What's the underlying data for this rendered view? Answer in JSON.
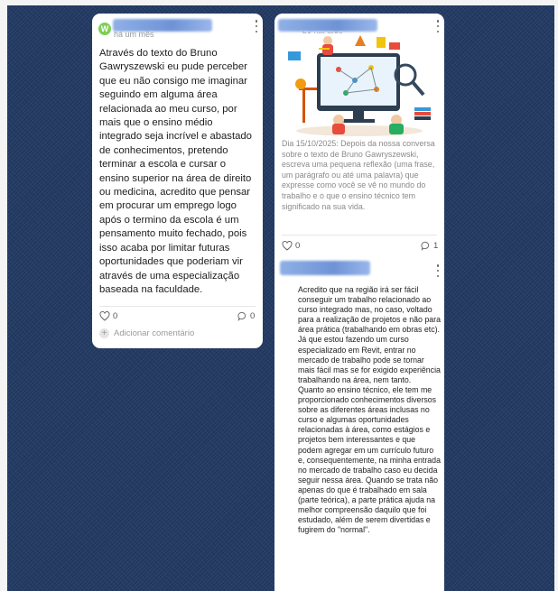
{
  "post1": {
    "time": "há um mês",
    "body": "Através do  texto do Bruno Gawryszewski eu pude perceber que eu não consigo me imaginar seguindo em alguma área relacionada ao meu curso, por mais que o ensino médio integrado seja incrível e abastado de conhecimentos, pretendo terminar a escola e cursar o ensino superior na área de direito ou medicina, acredito que pensar em procurar um emprego logo após o termino da escola é um pensamento muito fechado, pois isso acaba por limitar futuras oportunidades que poderiam vir através de uma especialização baseada na faculdade.",
    "likes": "0",
    "comments": "0",
    "add_comment": "Adicionar comentário"
  },
  "post2": {
    "time": "há um mês",
    "caption": "Dia 15/10/2025: Depois da nossa conversa sobre o texto de Bruno Gawryszewski, escreva uma pequena reflexão (uma frase, um parágrafo ou até uma palavra) que expresse como você se vê no mundo do trabalho e o que o ensino técnico tem significado na sua vida.",
    "likes": "0",
    "comments": "1"
  },
  "reply": {
    "paragraph1": "Acredito que na região irá ser fácil conseguir um trabalho relacionado ao curso integrado mas, no caso, voltado para a realização de projetos e não para área prática (trabalhando em obras etc). Já que estou fazendo um curso especializado em Revit, entrar no mercado de trabalho pode se tornar mais fácil mas se for exigido experiência trabalhando na área, nem tanto.",
    "paragraph2": "Quanto ao ensino técnico, ele tem me proporcionado conhecimentos diversos sobre as diferentes áreas inclusas no curso e algumas oportunidades relacionadas à área, como estágios e projetos bem interessantes e que podem agregar em um currículo futuro e, consequentemente, na minha entrada no mercado de trabalho caso eu decida seguir nessa área. Quando se trata não apenas do que é trabalhado em sala (parte teórica), a parte prática ajuda na melhor compreensão daquilo que foi estudado, além de serem divertidas e fugirem do \"normal\"."
  },
  "colors": {
    "background": "#233a63",
    "card": "#ffffff",
    "avatar": "#7dcf56",
    "muted_text": "#8a8a8a"
  },
  "icons": [
    "kebab-menu-icon",
    "heart-icon",
    "comment-icon",
    "plus-icon"
  ]
}
